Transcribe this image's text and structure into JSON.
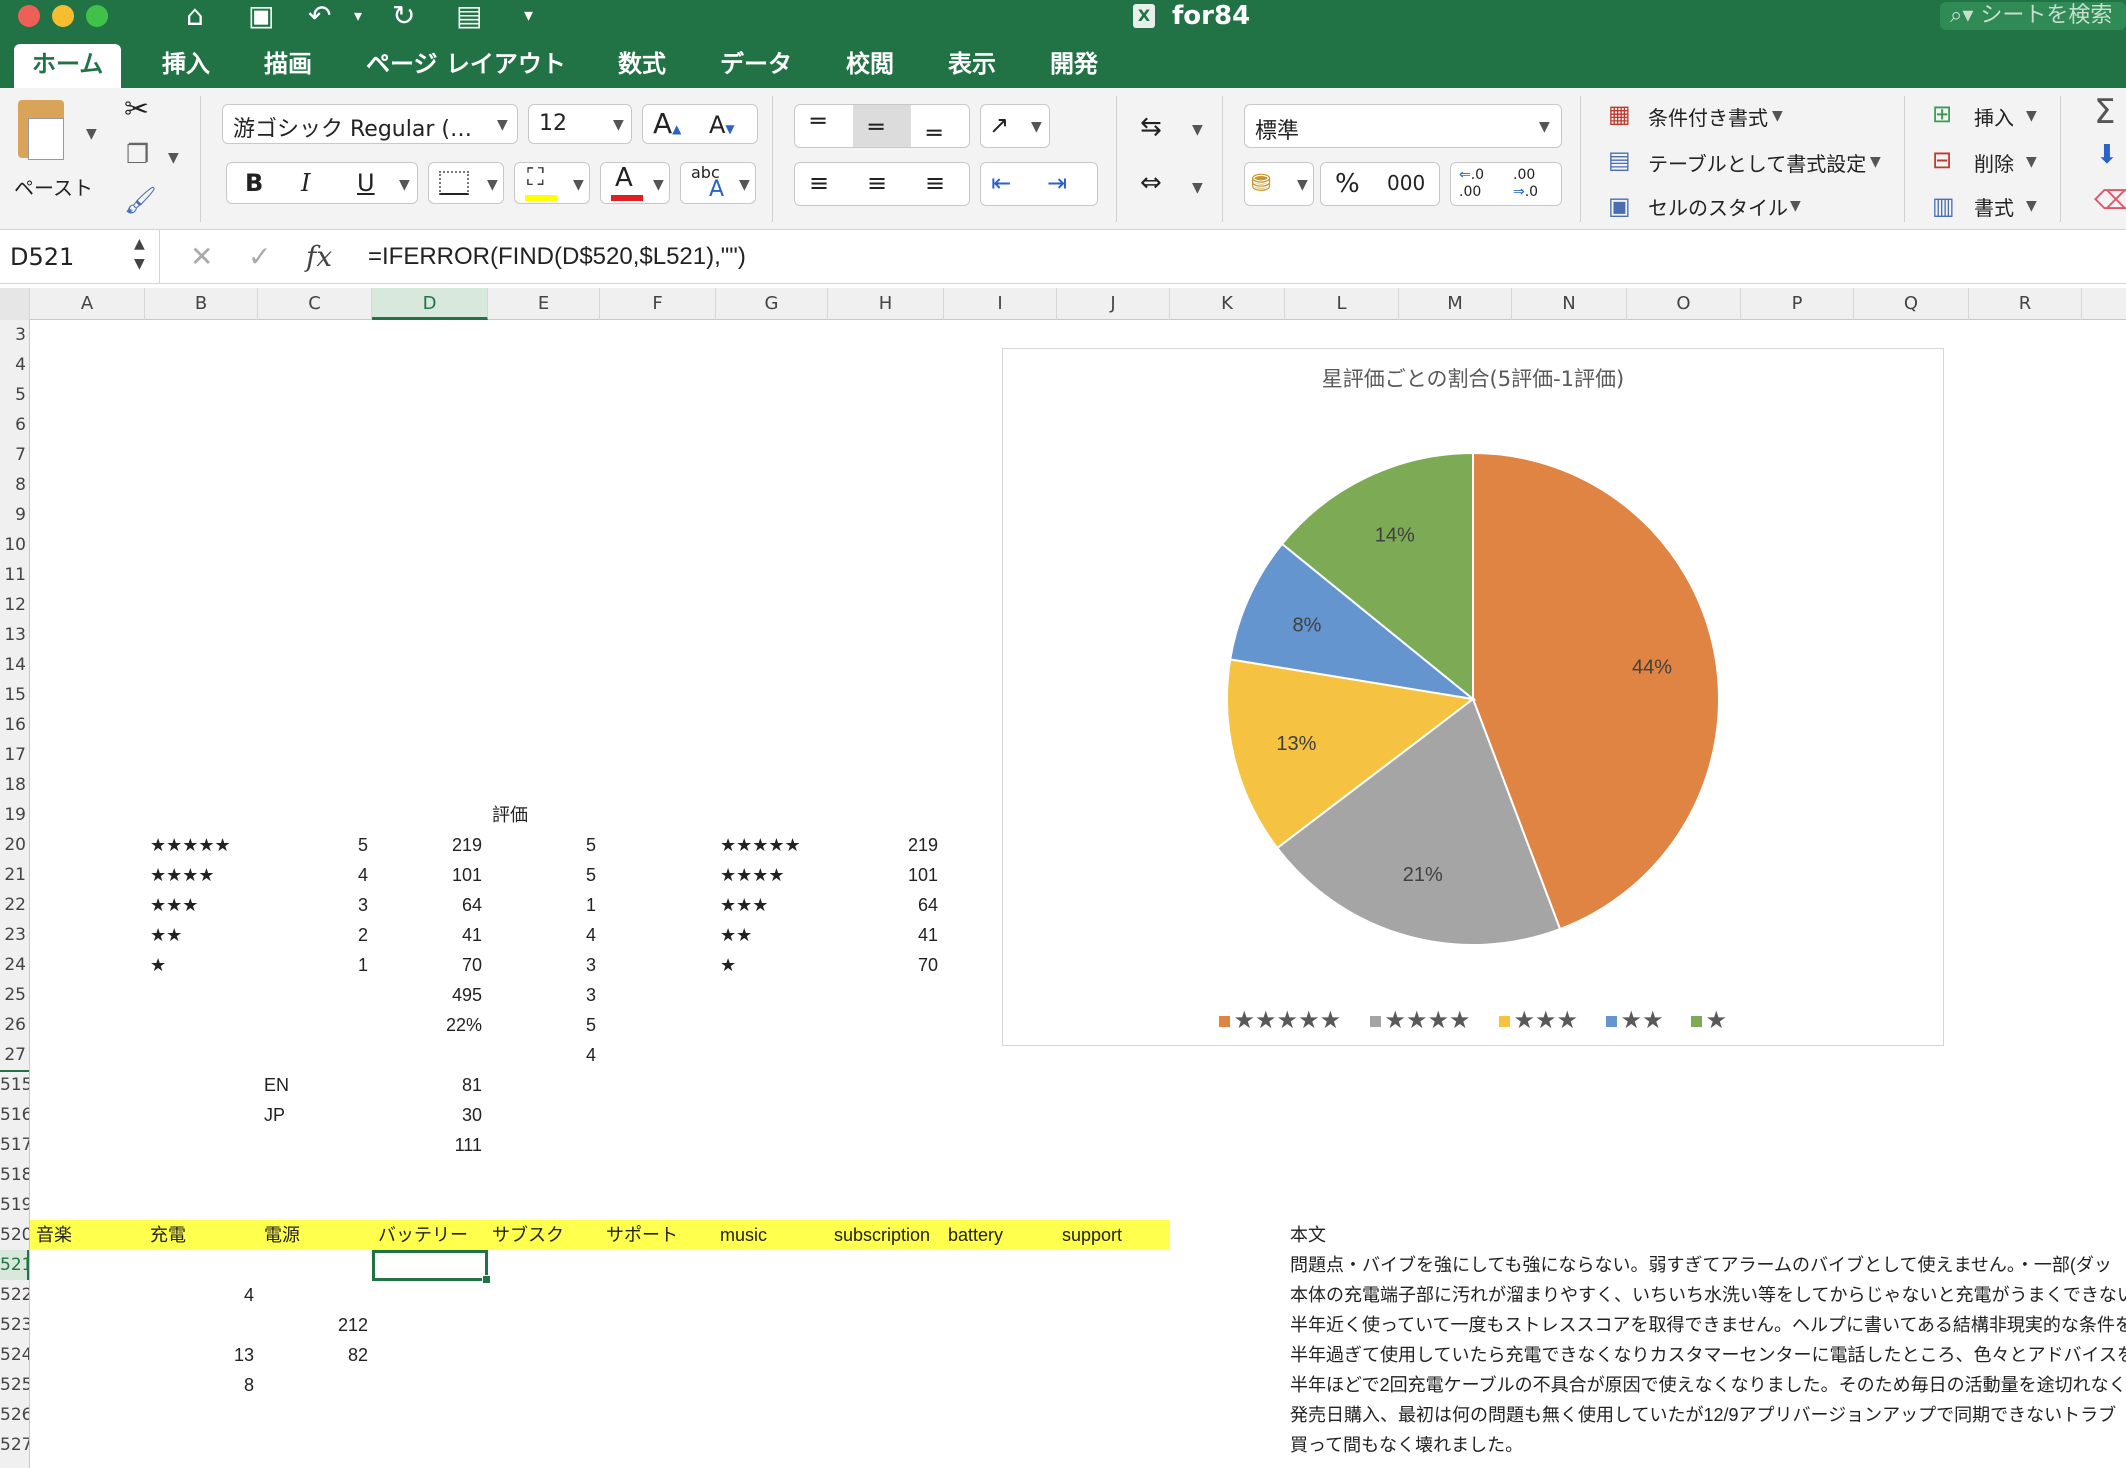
{
  "window": {
    "title": "for84",
    "search_placeholder": "シートを検索"
  },
  "tabs": [
    "ホーム",
    "挿入",
    "描画",
    "ページ レイアウト",
    "数式",
    "データ",
    "校閲",
    "表示",
    "開発"
  ],
  "ribbon": {
    "paste_label": "ペースト",
    "font_name": "游ゴシック Regular (…",
    "font_size": "12",
    "bold": "B",
    "italic": "I",
    "underline": "U",
    "number_format": "標準",
    "percent": "%",
    "thousands": "000",
    "inc_decimal": ".00",
    "dec_decimal": ".0",
    "conditional_format": "条件付き書式",
    "format_as_table": "テーブルとして書式設定",
    "cell_styles": "セルのスタイル",
    "insert": "挿入",
    "delete": "削除",
    "format": "書式",
    "font_grow": "A",
    "font_shrink": "A",
    "font_color_glyph": "A",
    "abc_glyph": "abc",
    "abc_sub": "A",
    "sigma": "Σ"
  },
  "formula_bar": {
    "name_box": "D521",
    "formula": "=IFERROR(FIND(D$520,$L521),\"\")"
  },
  "columns": [
    "A",
    "B",
    "C",
    "D",
    "E",
    "F",
    "G",
    "H",
    "I",
    "J",
    "K",
    "L",
    "M",
    "N",
    "O",
    "P",
    "Q",
    "R"
  ],
  "rows": [
    "3",
    "4",
    "5",
    "6",
    "7",
    "8",
    "9",
    "10",
    "11",
    "12",
    "13",
    "14",
    "15",
    "16",
    "17",
    "18",
    "19",
    "20",
    "21",
    "22",
    "23",
    "24",
    "25",
    "26",
    "27",
    "515",
    "516",
    "517",
    "518",
    "519",
    "520",
    "521",
    "522",
    "523",
    "524",
    "525",
    "526",
    "527"
  ],
  "cells": {
    "header_hyouka": "評価",
    "ratings": [
      {
        "stars": "★★★★★",
        "score": "5",
        "count": "219",
        "e": "5",
        "g": "★★★★★",
        "h": "219"
      },
      {
        "stars": "★★★★",
        "score": "4",
        "count": "101",
        "e": "5",
        "g": "★★★★",
        "h": "101"
      },
      {
        "stars": "★★★",
        "score": "3",
        "count": "64",
        "e": "1",
        "g": "★★★",
        "h": "64"
      },
      {
        "stars": "★★",
        "score": "2",
        "count": "41",
        "e": "4",
        "g": "★★",
        "h": "41"
      },
      {
        "stars": "★",
        "score": "1",
        "count": "70",
        "e": "3",
        "g": "★",
        "h": "70"
      }
    ],
    "d25": "495",
    "e25": "3",
    "d26": "22%",
    "e26": "5",
    "e27": "4",
    "c515": "EN",
    "d515": "81",
    "c516": "JP",
    "d516": "30",
    "d517": "111",
    "row520": [
      "音楽",
      "充電",
      "電源",
      "バッテリー",
      "サブスク",
      "サポート",
      "music",
      "subscription",
      "battery",
      "support"
    ],
    "c522": "4",
    "d523": "212",
    "c524": "13",
    "d524": "82",
    "c525": "8",
    "body_header": "本文",
    "body_lines": [
      "問題点・バイブを強にしても強にならない。弱すぎてアラームのバイブとして使えません。・一部(ダッ",
      "本体の充電端子部に汚れが溜まりやすく、いちいち水洗い等をしてからじゃないと充電がうまくできない",
      "半年近く使っていて一度もストレススコアを取得できません。ヘルプに書いてある結構非現実的な条件を",
      "半年過ぎて使用していたら充電できなくなりカスタマーセンターに電話したところ、色々とアドバイスを",
      "半年ほどで2回充電ケーブルの不具合が原因で使えなくなりました。そのため毎日の活動量を途切れなく",
      "発売日購入、最初は何の問題も無く使用していたが12/9アプリバージョンアップで同期できないトラブ",
      "買って間もなく壊れました。"
    ]
  },
  "chart_data": {
    "type": "pie",
    "title": "星評価ごとの割合(5評価-1評価)",
    "categories": [
      "★★★★★",
      "★★★★",
      "★★★",
      "★★",
      "★"
    ],
    "values": [
      219,
      101,
      64,
      41,
      70
    ],
    "data_labels": [
      "44%",
      "21%",
      "13%",
      "8%",
      "14%"
    ],
    "colors": [
      "#e08443",
      "#a5a5a5",
      "#f5c242",
      "#6495cf",
      "#7caa55"
    ],
    "legend_position": "bottom"
  }
}
